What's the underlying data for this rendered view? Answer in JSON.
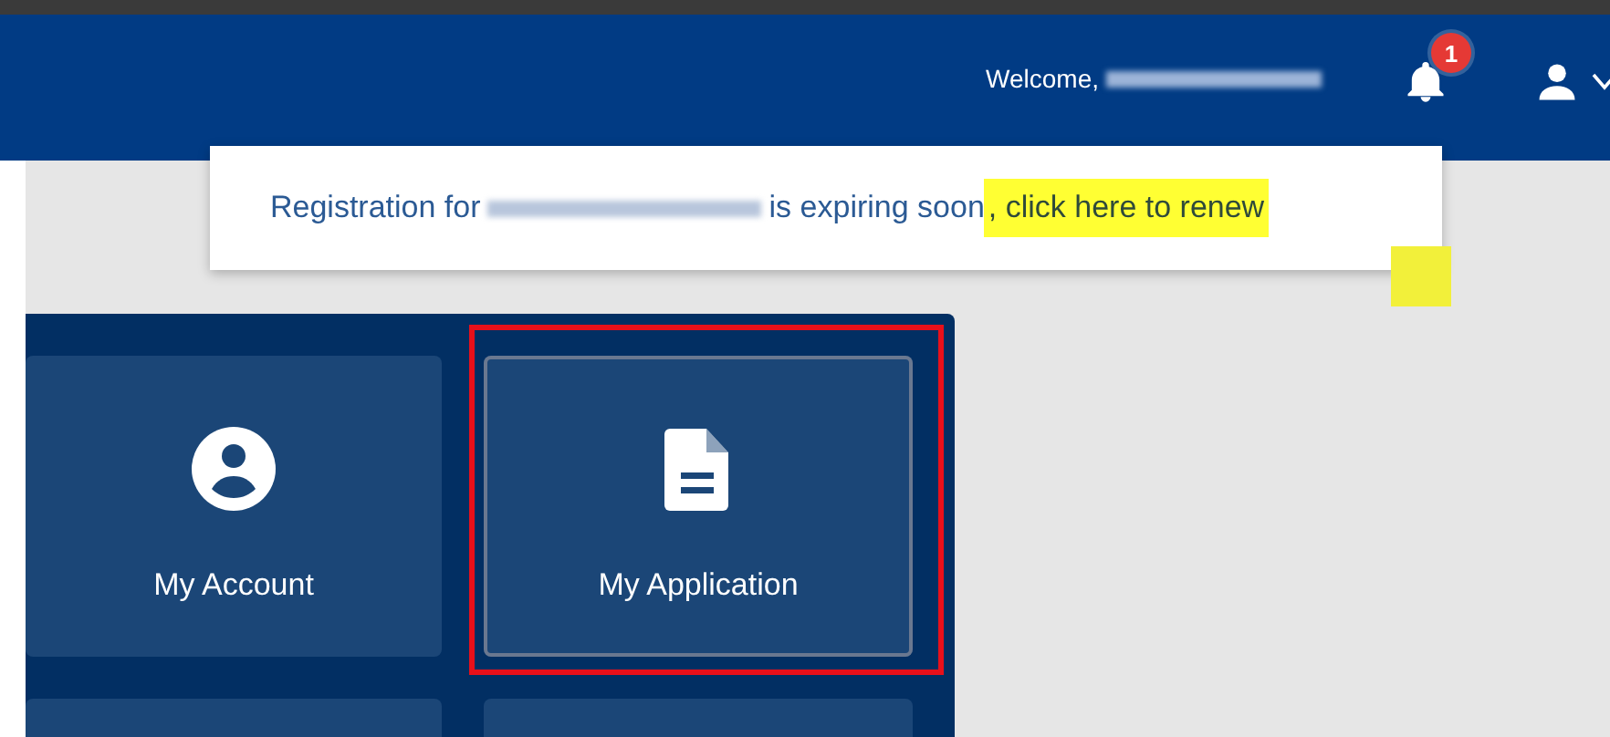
{
  "header": {
    "welcome": "Welcome,",
    "notifications": {
      "badge": "1"
    }
  },
  "notification": {
    "text_before": "Registration for",
    "text_after": "is expiring soon",
    "link": ", click here to renew",
    "link_highlighted": true
  },
  "tiles": [
    {
      "label": "My Account",
      "kind": "account",
      "highlighted": false
    },
    {
      "label": "My Application",
      "kind": "document",
      "highlighted": true
    },
    {
      "highlighted": false
    },
    {
      "highlighted": false
    }
  ]
}
